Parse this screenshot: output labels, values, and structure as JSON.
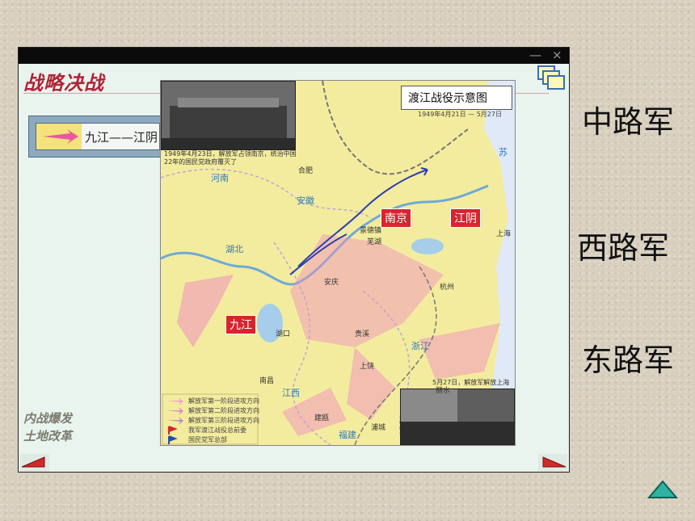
{
  "window": {
    "minimize_symbol": "—",
    "close_symbol": "×",
    "heading": "战略决战"
  },
  "route": {
    "label": "九江——江阴"
  },
  "map": {
    "title": "渡江战役示意图",
    "subtitle_date": "1949年4月21日 — 5月27日",
    "cities": {
      "nanjing": "南京",
      "jiangyin": "江阴",
      "jiujiang": "九江"
    },
    "small_labels": {
      "hefei": "合肥",
      "wuhu": "芜湖",
      "anqing": "安庆",
      "hukou": "湖口",
      "nanchang": "南昌",
      "hangzhou": "杭州",
      "shanghai": "上海",
      "guixi": "贵溪",
      "shangrao": "上饶",
      "lishui": "丽水",
      "jianou": "建瓯",
      "pucheng": "浦城",
      "jingdezhen": "景德镇",
      "province_henan": "河南",
      "province_hubei": "湖北",
      "province_anhui": "安徽",
      "province_jiangxi": "江西",
      "province_zhejiang": "浙江",
      "province_fujian": "福建",
      "province_jiangsu": "苏"
    },
    "photo_caption_top": "1949年4月23日，解放军占领南京，统治中国22年的国民党政府覆灭了",
    "photo_caption_bottom": "5月27日，解放军解放上海",
    "legend": [
      "解放军第一阶段进攻方向",
      "解放军第二阶段进攻方向",
      "解放军第三阶段进攻方向",
      "我军渡江战役总前委",
      "国民党军总部"
    ],
    "colors": {
      "land": "#f3ec9e",
      "attack": "#f08fc0",
      "river": "#6fa9d8",
      "flag": "#d7252f"
    }
  },
  "side_links": [
    "内战爆发",
    "土地改革"
  ],
  "armies": [
    "中路军",
    "西路军",
    "东路军"
  ],
  "nav": {
    "prev_icon": "left-triangle-icon",
    "next_icon": "right-triangle-icon",
    "up_icon": "up-triangle-icon"
  }
}
